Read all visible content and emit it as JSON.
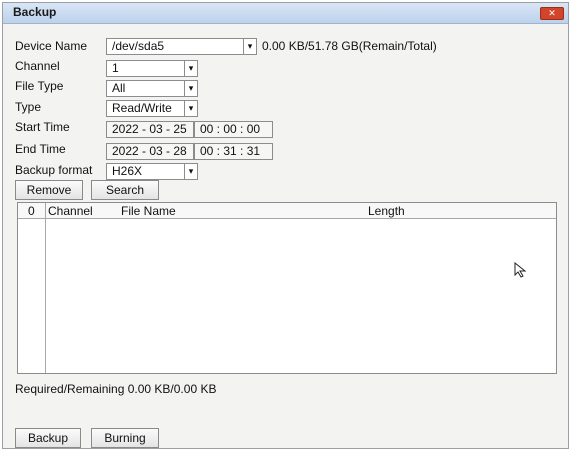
{
  "window": {
    "title": "Backup",
    "close_icon": "close-icon"
  },
  "fields": {
    "device_name": {
      "label": "Device Name",
      "value": "/dev/sda5",
      "capacity": "0.00 KB/51.78 GB(Remain/Total)"
    },
    "channel": {
      "label": "Channel",
      "value": "1"
    },
    "file_type": {
      "label": "File Type",
      "value": "All"
    },
    "type": {
      "label": "Type",
      "value": "Read/Write"
    },
    "start_time": {
      "label": "Start Time",
      "date": "2022 - 03 - 25",
      "time": "00 : 00 : 00"
    },
    "end_time": {
      "label": "End Time",
      "date": "2022 - 03 - 28",
      "time": "00 : 31 : 31"
    },
    "backup_format": {
      "label": "Backup format",
      "value": "H26X"
    }
  },
  "buttons": {
    "remove": "Remove",
    "search": "Search",
    "backup": "Backup",
    "burning": "Burning"
  },
  "table": {
    "columns": [
      "0",
      "Channel",
      "File Name",
      "Length"
    ],
    "rows": []
  },
  "status": {
    "required_remaining": "Required/Remaining 0.00 KB/0.00 KB"
  },
  "dropdown_glyph": "▾"
}
